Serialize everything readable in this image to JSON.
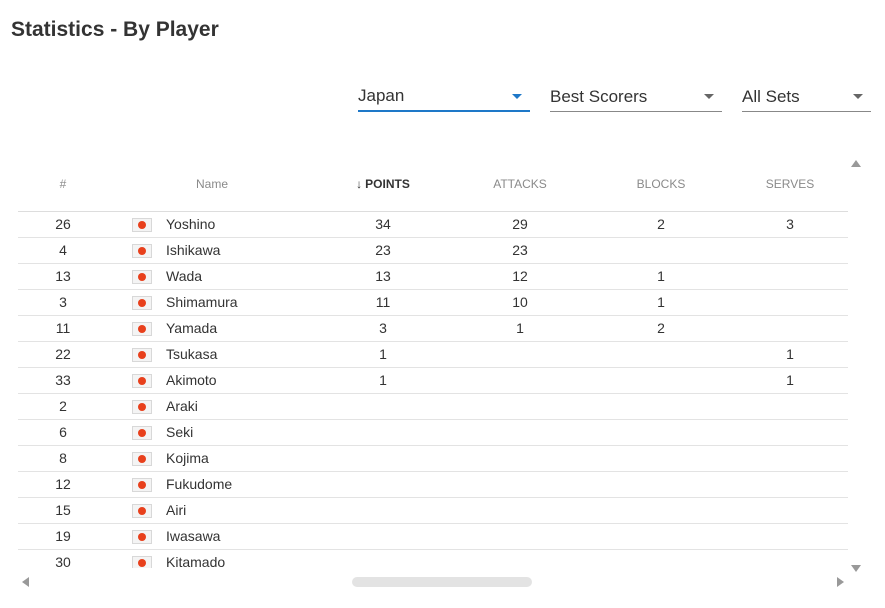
{
  "title": "Statistics - By Player",
  "filters": {
    "team": "Japan",
    "category": "Best Scorers",
    "sets": "All Sets"
  },
  "columns": [
    "#",
    "Name",
    "POINTS",
    "ATTACKS",
    "BLOCKS",
    "SERVES"
  ],
  "sort": {
    "column": "POINTS",
    "icon": "arrow-down-icon"
  },
  "rows": [
    {
      "num": "26",
      "name": "Yoshino",
      "points": "34",
      "attacks": "29",
      "blocks": "2",
      "serves": "3"
    },
    {
      "num": "4",
      "name": "Ishikawa",
      "points": "23",
      "attacks": "23",
      "blocks": "",
      "serves": ""
    },
    {
      "num": "13",
      "name": "Wada",
      "points": "13",
      "attacks": "12",
      "blocks": "1",
      "serves": ""
    },
    {
      "num": "3",
      "name": "Shimamura",
      "points": "11",
      "attacks": "10",
      "blocks": "1",
      "serves": ""
    },
    {
      "num": "11",
      "name": "Yamada",
      "points": "3",
      "attacks": "1",
      "blocks": "2",
      "serves": ""
    },
    {
      "num": "22",
      "name": "Tsukasa",
      "points": "1",
      "attacks": "",
      "blocks": "",
      "serves": "1"
    },
    {
      "num": "33",
      "name": "Akimoto",
      "points": "1",
      "attacks": "",
      "blocks": "",
      "serves": "1"
    },
    {
      "num": "2",
      "name": "Araki",
      "points": "",
      "attacks": "",
      "blocks": "",
      "serves": ""
    },
    {
      "num": "6",
      "name": "Seki",
      "points": "",
      "attacks": "",
      "blocks": "",
      "serves": ""
    },
    {
      "num": "8",
      "name": "Kojima",
      "points": "",
      "attacks": "",
      "blocks": "",
      "serves": ""
    },
    {
      "num": "12",
      "name": "Fukudome",
      "points": "",
      "attacks": "",
      "blocks": "",
      "serves": ""
    },
    {
      "num": "15",
      "name": "Airi",
      "points": "",
      "attacks": "",
      "blocks": "",
      "serves": ""
    },
    {
      "num": "19",
      "name": "Iwasawa",
      "points": "",
      "attacks": "",
      "blocks": "",
      "serves": ""
    },
    {
      "num": "30",
      "name": "Kitamado",
      "points": "",
      "attacks": "",
      "blocks": "",
      "serves": ""
    }
  ],
  "flag_icon": "japan-flag-icon",
  "colors": {
    "accent": "#1e78c8",
    "flag_red": "#e8401c"
  }
}
